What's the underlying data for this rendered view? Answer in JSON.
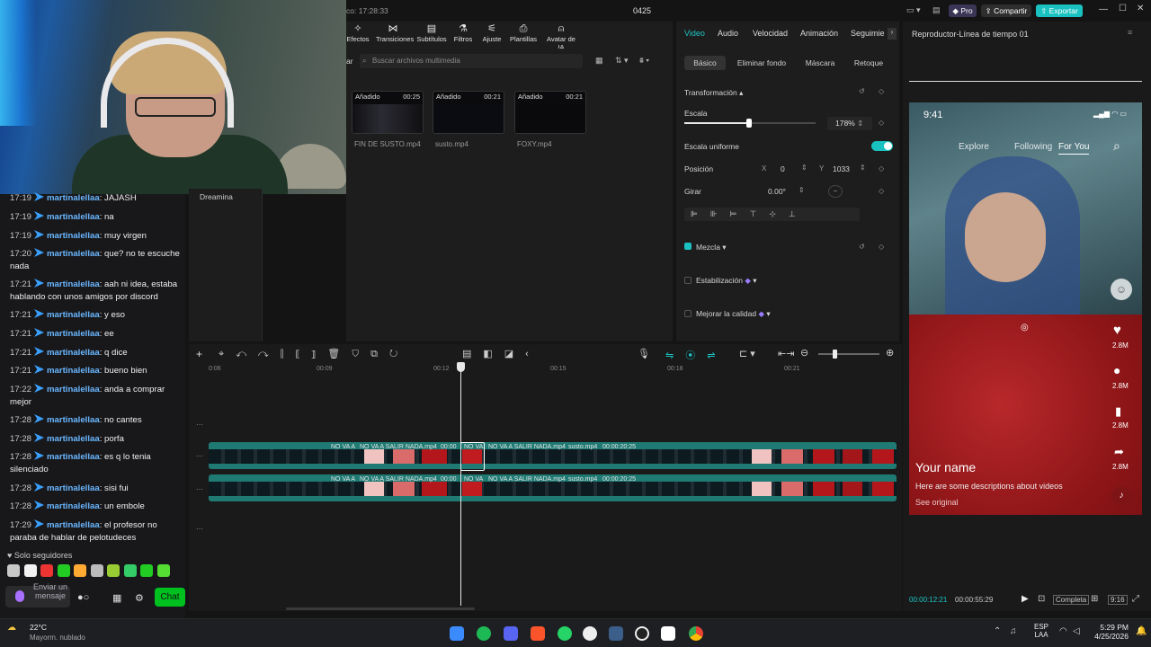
{
  "stream": {
    "title_time": "co: 17:28:33",
    "project_name": "0425"
  },
  "chat": {
    "messages": [
      {
        "time": "17:19",
        "user": "martinalellaa",
        "text": "JAJASH"
      },
      {
        "time": "17:19",
        "user": "martinalellaa",
        "text": "na"
      },
      {
        "time": "17:19",
        "user": "martinalellaa",
        "text": "muy virgen"
      },
      {
        "time": "17:20",
        "user": "martinalellaa",
        "text": "que? no te escuche nada"
      },
      {
        "time": "17:21",
        "user": "martinalellaa",
        "text": "aah ni idea, estaba hablando con unos amigos por discord"
      },
      {
        "time": "17:21",
        "user": "martinalellaa",
        "text": "y eso"
      },
      {
        "time": "17:21",
        "user": "martinalellaa",
        "text": "ee"
      },
      {
        "time": "17:21",
        "user": "martinalellaa",
        "text": "q dice"
      },
      {
        "time": "17:21",
        "user": "martinalellaa",
        "text": "bueno bien"
      },
      {
        "time": "17:22",
        "user": "martinalellaa",
        "text": "anda a comprar mejor"
      },
      {
        "time": "17:28",
        "user": "martinalellaa",
        "text": "no cantes"
      },
      {
        "time": "17:28",
        "user": "martinalellaa",
        "text": "porfa"
      },
      {
        "time": "17:28",
        "user": "martinalellaa",
        "text": "es q lo tenia silenciado"
      },
      {
        "time": "17:28",
        "user": "martinalellaa",
        "text": "sisi fui"
      },
      {
        "time": "17:28",
        "user": "martinalellaa",
        "text": "un embole"
      },
      {
        "time": "17:29",
        "user": "martinalellaa",
        "text": "el profesor no paraba de hablar de pelotudeces"
      }
    ],
    "followers_only": "Solo seguidores",
    "send_placeholder": "Enviar un mensaje",
    "chat_button": "Chat"
  },
  "header": {
    "pro": "Pro",
    "share": "Compartir",
    "export": "Exportar",
    "player_title": "Reproductor-Línea de tiempo 01"
  },
  "toolbar": {
    "items": [
      "Efectos",
      "Transiciones",
      "Subtítulos",
      "Filtros",
      "Ajuste",
      "Plantillas",
      "Avatar de IA"
    ]
  },
  "media": {
    "import_fragment": "ar",
    "search_placeholder": "Buscar archivos multimedia",
    "left_item": "Dreamina",
    "clips": [
      {
        "tag": "Añadido",
        "duration": "00:25",
        "name": "FIN DE SUSTO.mp4"
      },
      {
        "tag": "Añadido",
        "duration": "00:21",
        "name": "susto.mp4"
      },
      {
        "tag": "Añadido",
        "duration": "00:21",
        "name": "FOXY.mp4"
      }
    ]
  },
  "props": {
    "tabs": [
      "Video",
      "Audio",
      "Velocidad",
      "Animación",
      "Seguimie"
    ],
    "subtabs": [
      "Básico",
      "Eliminar fondo",
      "Máscara",
      "Retoque"
    ],
    "section_transform": "Transformación",
    "scale_label": "Escala",
    "scale_value": "178%",
    "scale_level": 0.49,
    "uniform_label": "Escala uniforme",
    "position_label": "Posición",
    "pos_x_label": "X",
    "pos_x": "0",
    "pos_y_label": "Y",
    "pos_y": "1033",
    "rotate_label": "Girar",
    "rotate_value": "0.00°",
    "blend_label": "Mezcla",
    "stabilize_label": "Estabilización",
    "enhance_label": "Mejorar la calidad"
  },
  "timeline": {
    "ruler": [
      "0:06",
      "00:09",
      "00:12",
      "00:15",
      "00:18",
      "00:21"
    ],
    "track_labels": [
      "NO VA A",
      "NO VA A SALIR NADA.mp4",
      "00:00",
      "NO VA",
      "NO VA A SALIR NADA.mp4",
      "susto.mp4",
      "00:00:20:25"
    ]
  },
  "phone": {
    "time": "9:41",
    "tabs": [
      "Explore",
      "Following",
      "For You"
    ],
    "likes": [
      "2.8M",
      "2.8M",
      "2.8M",
      "2.8M"
    ],
    "name": "Your name",
    "desc": "Here are some descriptions about videos",
    "see": "See original"
  },
  "player": {
    "current": "00:00:12:21",
    "total": "00:00:55:29",
    "complete": "Completa",
    "ratio": "9:16"
  },
  "taskbar": {
    "temp": "22°C",
    "weather": "Mayorm. nublado",
    "lang": "ESP",
    "region": "LAA",
    "clock": "5:29 PM",
    "date": "4/25/2026"
  }
}
